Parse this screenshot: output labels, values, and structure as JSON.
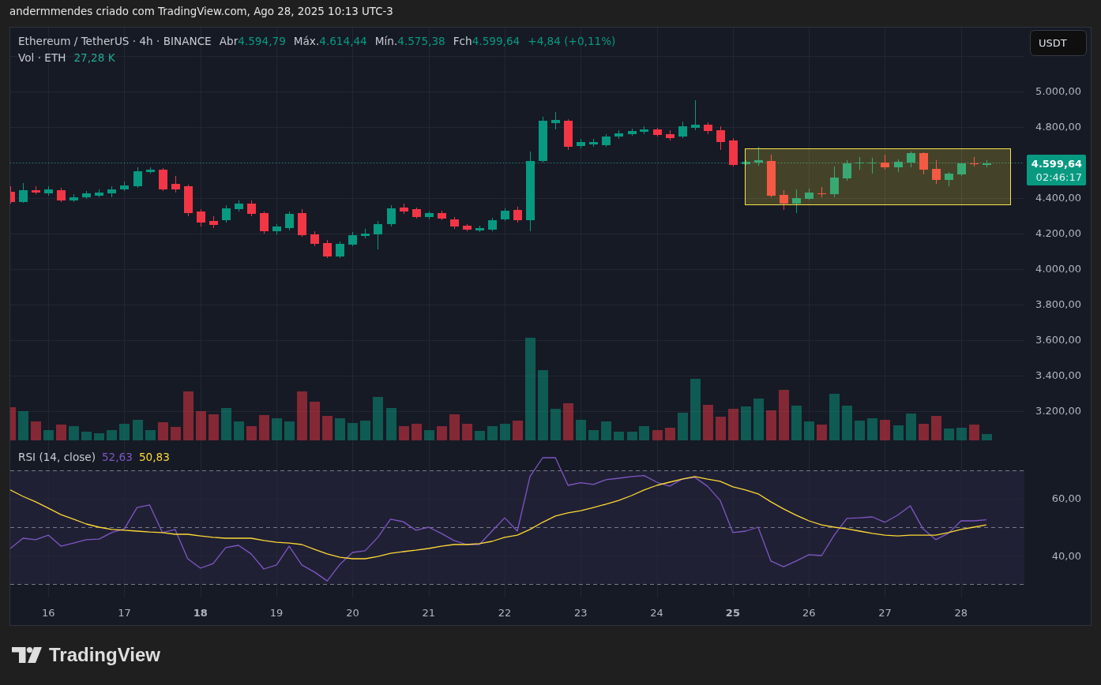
{
  "header": {
    "attribution": "andermmendes criado com TradingView.com, Ago 28, 2025 10:13 UTC-3"
  },
  "legend": {
    "symbol": "Ethereum / TetherUS · 4h · BINANCE",
    "rising": true,
    "ohlc": [
      {
        "label": "Abr",
        "value": "4.594,79"
      },
      {
        "label": "Máx.",
        "value": "4.614,44"
      },
      {
        "label": "Mín.",
        "value": "4.575,38"
      },
      {
        "label": "Fch",
        "value": "4.599,64"
      }
    ],
    "change": "+4,84 (+0,11%)",
    "volume": {
      "label": "Vol · ETH",
      "value": "27,28 K"
    }
  },
  "currency_button": {
    "label": "USDT"
  },
  "price_axis": {
    "items": [
      {
        "kind": "label",
        "text": "5.000,00"
      },
      {
        "kind": "label",
        "text": "4.800,00"
      },
      {
        "kind": "last_price",
        "text": "4.599,64",
        "countdown": "02:46:17"
      },
      {
        "kind": "label",
        "text": "4.400,00"
      },
      {
        "kind": "label",
        "text": "4.200,00"
      },
      {
        "kind": "label",
        "text": "4.000,00"
      },
      {
        "kind": "label",
        "text": "3.800,00"
      },
      {
        "kind": "label",
        "text": "3.600,00"
      },
      {
        "kind": "label",
        "text": "3.400,00"
      },
      {
        "kind": "label",
        "text": "3.200,00"
      }
    ]
  },
  "rsi": {
    "title": "RSI (14, close)",
    "values": [
      "52,63",
      "50,83"
    ],
    "chart_data": {
      "type": "line",
      "grid": true,
      "x": [
        15.5,
        15.667,
        15.833,
        16,
        16.167,
        16.333,
        16.5,
        16.667,
        16.833,
        17,
        17.167,
        17.333,
        17.5,
        17.667,
        17.833,
        18,
        18.167,
        18.333,
        18.5,
        18.667,
        18.833,
        19,
        19.167,
        19.333,
        19.5,
        19.667,
        19.833,
        20,
        20.167,
        20.333,
        20.5,
        20.667,
        20.833,
        21,
        21.167,
        21.333,
        21.5,
        21.667,
        21.833,
        22,
        22.167,
        22.333,
        22.5,
        22.667,
        22.833,
        23,
        23.167,
        23.333,
        23.5,
        23.667,
        23.833,
        24,
        24.167,
        24.333,
        24.5,
        24.667,
        24.833,
        25,
        25.167,
        25.333,
        25.5,
        25.667,
        25.833,
        26,
        26.167,
        26.333,
        26.5,
        26.667,
        26.833,
        27,
        27.167,
        27.333,
        27.5,
        27.667,
        27.833,
        28,
        28.167,
        28.333
      ],
      "xlim": [
        15.5,
        28.833
      ],
      "ylim": [
        25.3,
        79.4
      ],
      "xticks": [
        16,
        17,
        18,
        19,
        20,
        21,
        22,
        23,
        24,
        25,
        26,
        27,
        28
      ],
      "yticks": [
        {
          "value": 60,
          "label": "60,00"
        },
        {
          "value": 40,
          "label": "40,00"
        }
      ],
      "series": [
        {
          "color": "#7e57c2",
          "values": [
            42.5,
            46.1,
            45.6,
            47.2,
            43.3,
            44.4,
            45.6,
            45.8,
            48.1,
            49.4,
            56.9,
            57.8,
            48.1,
            49.2,
            38.9,
            35.6,
            37.2,
            42.8,
            43.6,
            40.6,
            35.3,
            36.7,
            43.3,
            36.7,
            34.2,
            31.1,
            36.9,
            41.1,
            41.7,
            46.4,
            52.8,
            51.9,
            48.9,
            50.0,
            47.8,
            45.3,
            43.9,
            43.9,
            48.6,
            53.3,
            48.6,
            67.8,
            74.4,
            74.4,
            64.7,
            65.6,
            65.0,
            66.7,
            67.2,
            67.8,
            68.1,
            65.8,
            64.4,
            66.9,
            67.5,
            64.4,
            59.4,
            48.1,
            48.6,
            50.0,
            38.1,
            36.1,
            38.1,
            40.3,
            40.0,
            47.2,
            53.1,
            53.3,
            53.6,
            51.7,
            54.2,
            57.5,
            49.4,
            45.6,
            47.8,
            52.2,
            52.2,
            52.6
          ]
        },
        {
          "color": "#fdd835",
          "values": [
            63.1,
            60.8,
            58.9,
            56.7,
            54.4,
            52.8,
            51.1,
            50.0,
            49.2,
            48.9,
            48.6,
            48.3,
            48.1,
            47.5,
            47.5,
            46.9,
            46.4,
            46.1,
            46.1,
            46.1,
            45.3,
            44.7,
            44.4,
            43.9,
            42.2,
            40.6,
            39.4,
            38.9,
            38.9,
            39.7,
            40.8,
            41.4,
            41.9,
            42.5,
            43.3,
            43.9,
            43.9,
            44.2,
            45.0,
            46.4,
            47.2,
            49.2,
            51.7,
            53.9,
            55.0,
            55.8,
            56.9,
            58.1,
            59.4,
            61.1,
            63.1,
            64.7,
            65.8,
            66.9,
            67.8,
            66.9,
            66.1,
            64.2,
            63.1,
            61.7,
            58.9,
            56.4,
            54.2,
            52.2,
            50.8,
            50.0,
            49.4,
            48.6,
            47.8,
            47.2,
            46.9,
            47.2,
            47.2,
            47.2,
            48.1,
            49.2,
            50.0,
            50.8
          ]
        }
      ]
    }
  },
  "time_axis": {
    "tick_bold": [
      false,
      false,
      true,
      false,
      false,
      false,
      false,
      false,
      false,
      true,
      false,
      false,
      false
    ]
  },
  "logo": {
    "text": "TradingView"
  }
}
